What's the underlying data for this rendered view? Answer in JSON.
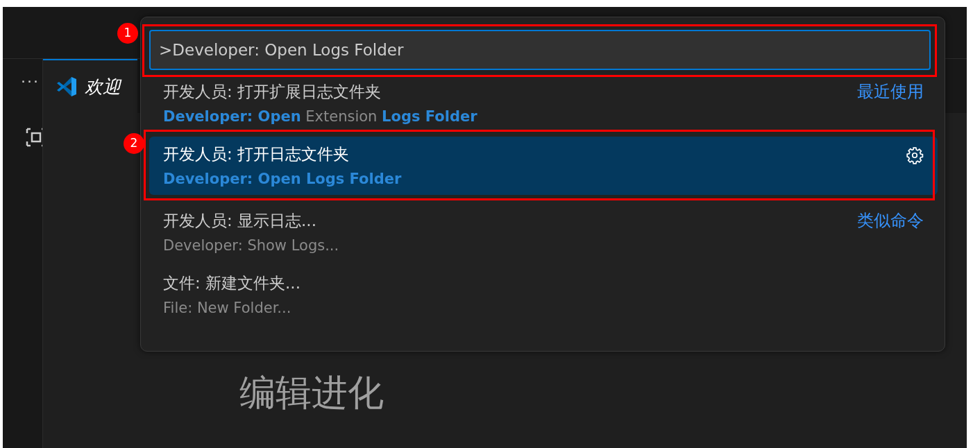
{
  "sidebar": {
    "items": [
      {
        "kind": "text",
        "text": "···"
      },
      {
        "kind": "icon"
      }
    ]
  },
  "tabs": [
    {
      "label": "欢迎",
      "selected": true
    }
  ],
  "editor": {
    "subtitle": "编辑进化"
  },
  "command_palette": {
    "input": {
      "value": ">Developer: Open Logs Folder"
    },
    "items": [
      {
        "label": "开发人员: 打开扩展日志文件夹",
        "detail": "**Developer: Open** Extension **Logs Folder**",
        "tag": "最近使用",
        "selected": false
      },
      {
        "label": "开发人员: 打开日志文件夹",
        "detail": "**Developer: Open Logs Folder**",
        "selected": true
      },
      {
        "label": "开发人员: 显示日志...",
        "detail": "Developer: Show Logs...",
        "tag": "类似命令",
        "selected": false
      },
      {
        "label": "文件: 新建文件夹...",
        "detail": "File: New Folder...",
        "selected": false
      }
    ]
  },
  "annotations": [
    {
      "kind": "input",
      "label": "1"
    },
    {
      "kind": "selected-row",
      "label": "2"
    }
  ]
}
